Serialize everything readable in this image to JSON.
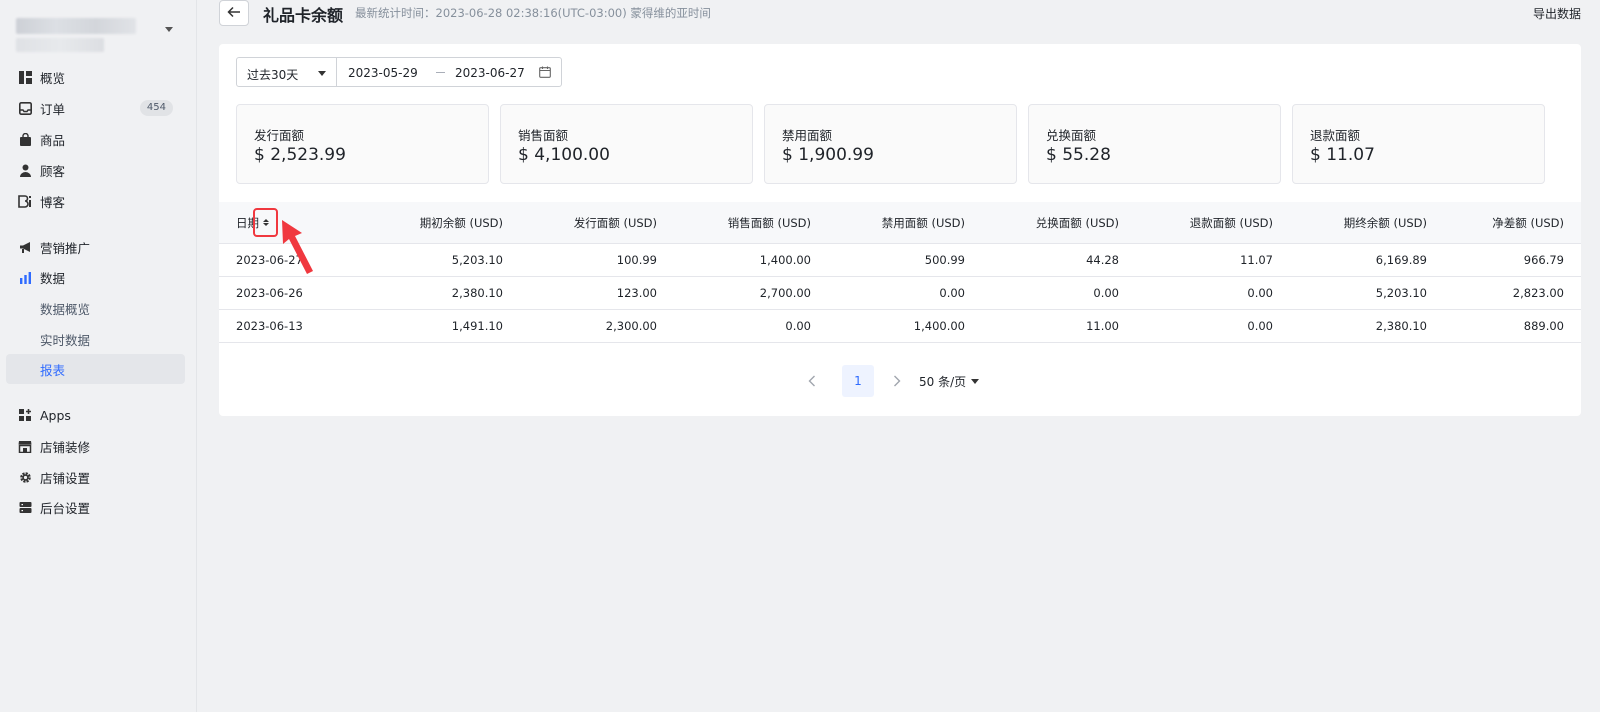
{
  "sidebar": {
    "items": [
      {
        "label": "概览"
      },
      {
        "label": "订单",
        "badge": "454"
      },
      {
        "label": "商品"
      },
      {
        "label": "顾客"
      },
      {
        "label": "博客"
      },
      {
        "label": "营销推广"
      },
      {
        "label": "数据"
      },
      {
        "label": "数据概览"
      },
      {
        "label": "实时数据"
      },
      {
        "label": "报表"
      },
      {
        "label": "Apps"
      },
      {
        "label": "店铺装修"
      },
      {
        "label": "店铺设置"
      },
      {
        "label": "后台设置"
      }
    ]
  },
  "header": {
    "title": "礼品卡余额",
    "stats_time": "最新统计时间：2023-06-28 02:38:16(UTC-03:00) 蒙得维的亚时间",
    "export_label": "导出数据"
  },
  "filters": {
    "range": "过去30天",
    "start_date": "2023-05-29",
    "end_date": "2023-06-27"
  },
  "kpis": [
    {
      "label": "发行面额",
      "value": "$ 2,523.99"
    },
    {
      "label": "销售面额",
      "value": "$ 4,100.00"
    },
    {
      "label": "禁用面额",
      "value": "$ 1,900.99"
    },
    {
      "label": "兑换面额",
      "value": "$ 55.28"
    },
    {
      "label": "退款面额",
      "value": "$ 11.07"
    }
  ],
  "table": {
    "columns": [
      "日期",
      "期初余额 (USD)",
      "发行面额 (USD)",
      "销售面额 (USD)",
      "禁用面额 (USD)",
      "兑换面额 (USD)",
      "退款面额 (USD)",
      "期终余额 (USD)",
      "净差额 (USD)"
    ],
    "rows": [
      [
        "2023-06-27",
        "5,203.10",
        "100.99",
        "1,400.00",
        "500.99",
        "44.28",
        "11.07",
        "6,169.89",
        "966.79"
      ],
      [
        "2023-06-26",
        "2,380.10",
        "123.00",
        "2,700.00",
        "0.00",
        "0.00",
        "0.00",
        "5,203.10",
        "2,823.00"
      ],
      [
        "2023-06-13",
        "1,491.10",
        "2,300.00",
        "0.00",
        "1,400.00",
        "11.00",
        "0.00",
        "2,380.10",
        "889.00"
      ]
    ]
  },
  "pagination": {
    "current": "1",
    "page_size": "50 条/页"
  },
  "colors": {
    "accent": "#2f6bff",
    "annotation": "#f0383f"
  }
}
